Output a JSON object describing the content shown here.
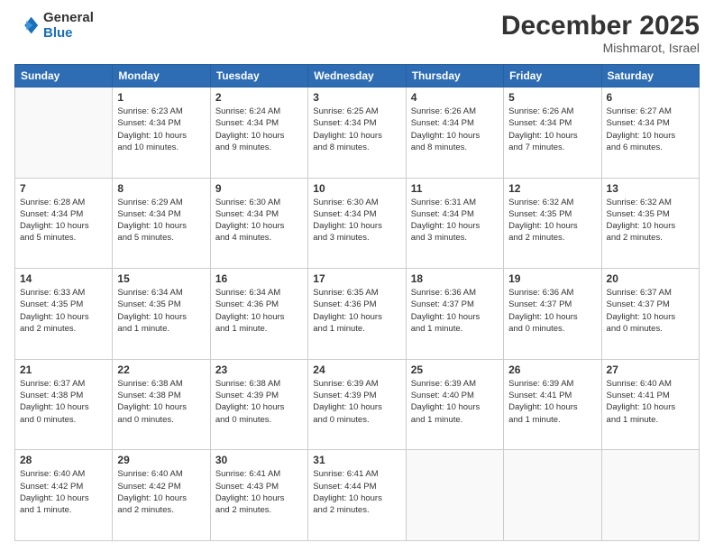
{
  "logo": {
    "general": "General",
    "blue": "Blue"
  },
  "header": {
    "month": "December 2025",
    "location": "Mishmarot, Israel"
  },
  "days_of_week": [
    "Sunday",
    "Monday",
    "Tuesday",
    "Wednesday",
    "Thursday",
    "Friday",
    "Saturday"
  ],
  "weeks": [
    [
      {
        "day": "",
        "info": ""
      },
      {
        "day": "1",
        "info": "Sunrise: 6:23 AM\nSunset: 4:34 PM\nDaylight: 10 hours\nand 10 minutes."
      },
      {
        "day": "2",
        "info": "Sunrise: 6:24 AM\nSunset: 4:34 PM\nDaylight: 10 hours\nand 9 minutes."
      },
      {
        "day": "3",
        "info": "Sunrise: 6:25 AM\nSunset: 4:34 PM\nDaylight: 10 hours\nand 8 minutes."
      },
      {
        "day": "4",
        "info": "Sunrise: 6:26 AM\nSunset: 4:34 PM\nDaylight: 10 hours\nand 8 minutes."
      },
      {
        "day": "5",
        "info": "Sunrise: 6:26 AM\nSunset: 4:34 PM\nDaylight: 10 hours\nand 7 minutes."
      },
      {
        "day": "6",
        "info": "Sunrise: 6:27 AM\nSunset: 4:34 PM\nDaylight: 10 hours\nand 6 minutes."
      }
    ],
    [
      {
        "day": "7",
        "info": "Sunrise: 6:28 AM\nSunset: 4:34 PM\nDaylight: 10 hours\nand 5 minutes."
      },
      {
        "day": "8",
        "info": "Sunrise: 6:29 AM\nSunset: 4:34 PM\nDaylight: 10 hours\nand 5 minutes."
      },
      {
        "day": "9",
        "info": "Sunrise: 6:30 AM\nSunset: 4:34 PM\nDaylight: 10 hours\nand 4 minutes."
      },
      {
        "day": "10",
        "info": "Sunrise: 6:30 AM\nSunset: 4:34 PM\nDaylight: 10 hours\nand 3 minutes."
      },
      {
        "day": "11",
        "info": "Sunrise: 6:31 AM\nSunset: 4:34 PM\nDaylight: 10 hours\nand 3 minutes."
      },
      {
        "day": "12",
        "info": "Sunrise: 6:32 AM\nSunset: 4:35 PM\nDaylight: 10 hours\nand 2 minutes."
      },
      {
        "day": "13",
        "info": "Sunrise: 6:32 AM\nSunset: 4:35 PM\nDaylight: 10 hours\nand 2 minutes."
      }
    ],
    [
      {
        "day": "14",
        "info": "Sunrise: 6:33 AM\nSunset: 4:35 PM\nDaylight: 10 hours\nand 2 minutes."
      },
      {
        "day": "15",
        "info": "Sunrise: 6:34 AM\nSunset: 4:35 PM\nDaylight: 10 hours\nand 1 minute."
      },
      {
        "day": "16",
        "info": "Sunrise: 6:34 AM\nSunset: 4:36 PM\nDaylight: 10 hours\nand 1 minute."
      },
      {
        "day": "17",
        "info": "Sunrise: 6:35 AM\nSunset: 4:36 PM\nDaylight: 10 hours\nand 1 minute."
      },
      {
        "day": "18",
        "info": "Sunrise: 6:36 AM\nSunset: 4:37 PM\nDaylight: 10 hours\nand 1 minute."
      },
      {
        "day": "19",
        "info": "Sunrise: 6:36 AM\nSunset: 4:37 PM\nDaylight: 10 hours\nand 0 minutes."
      },
      {
        "day": "20",
        "info": "Sunrise: 6:37 AM\nSunset: 4:37 PM\nDaylight: 10 hours\nand 0 minutes."
      }
    ],
    [
      {
        "day": "21",
        "info": "Sunrise: 6:37 AM\nSunset: 4:38 PM\nDaylight: 10 hours\nand 0 minutes."
      },
      {
        "day": "22",
        "info": "Sunrise: 6:38 AM\nSunset: 4:38 PM\nDaylight: 10 hours\nand 0 minutes."
      },
      {
        "day": "23",
        "info": "Sunrise: 6:38 AM\nSunset: 4:39 PM\nDaylight: 10 hours\nand 0 minutes."
      },
      {
        "day": "24",
        "info": "Sunrise: 6:39 AM\nSunset: 4:39 PM\nDaylight: 10 hours\nand 0 minutes."
      },
      {
        "day": "25",
        "info": "Sunrise: 6:39 AM\nSunset: 4:40 PM\nDaylight: 10 hours\nand 1 minute."
      },
      {
        "day": "26",
        "info": "Sunrise: 6:39 AM\nSunset: 4:41 PM\nDaylight: 10 hours\nand 1 minute."
      },
      {
        "day": "27",
        "info": "Sunrise: 6:40 AM\nSunset: 4:41 PM\nDaylight: 10 hours\nand 1 minute."
      }
    ],
    [
      {
        "day": "28",
        "info": "Sunrise: 6:40 AM\nSunset: 4:42 PM\nDaylight: 10 hours\nand 1 minute."
      },
      {
        "day": "29",
        "info": "Sunrise: 6:40 AM\nSunset: 4:42 PM\nDaylight: 10 hours\nand 2 minutes."
      },
      {
        "day": "30",
        "info": "Sunrise: 6:41 AM\nSunset: 4:43 PM\nDaylight: 10 hours\nand 2 minutes."
      },
      {
        "day": "31",
        "info": "Sunrise: 6:41 AM\nSunset: 4:44 PM\nDaylight: 10 hours\nand 2 minutes."
      },
      {
        "day": "",
        "info": ""
      },
      {
        "day": "",
        "info": ""
      },
      {
        "day": "",
        "info": ""
      }
    ]
  ]
}
